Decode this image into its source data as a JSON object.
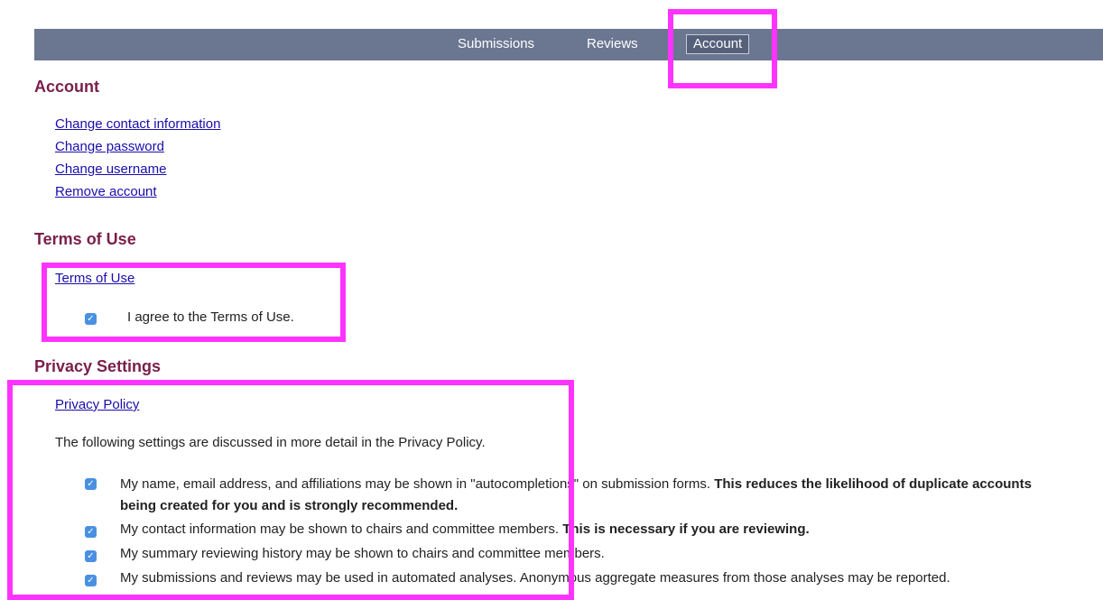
{
  "nav": {
    "items": [
      {
        "label": "Submissions"
      },
      {
        "label": "Reviews"
      },
      {
        "label": "Account",
        "active": true
      }
    ]
  },
  "account": {
    "title": "Account",
    "links": [
      "Change contact information",
      "Change password",
      "Change username",
      "Remove account"
    ]
  },
  "terms": {
    "title": "Terms of Use",
    "link": "Terms of Use",
    "agree_label": "I agree to the Terms of Use.",
    "agree_checked": true
  },
  "privacy": {
    "title": "Privacy Settings",
    "link": "Privacy Policy",
    "intro": "The following settings are discussed in more detail in the Privacy Policy.",
    "settings": [
      {
        "text": "My name, email address, and affiliations may be shown in \"autocompletions\" on submission forms.",
        "bold": "This reduces the likelihood of duplicate accounts being created for you and is strongly recommended.",
        "checked": true
      },
      {
        "text": "My contact information may be shown to chairs and committee members.",
        "bold": "This is necessary if you are reviewing.",
        "checked": true
      },
      {
        "text": "My summary reviewing history may be shown to chairs and committee members.",
        "bold": "",
        "checked": true
      },
      {
        "text": "My submissions and reviews may be used in automated analyses. Anonymous aggregate measures from those analyses may be reported.",
        "bold": "",
        "checked": true
      }
    ]
  },
  "colors": {
    "navbar": "#6b7691",
    "heading": "#7a1f4b",
    "link": "#1a0dab",
    "highlight": "#ff33ff",
    "checkbox": "#4a90e2"
  }
}
